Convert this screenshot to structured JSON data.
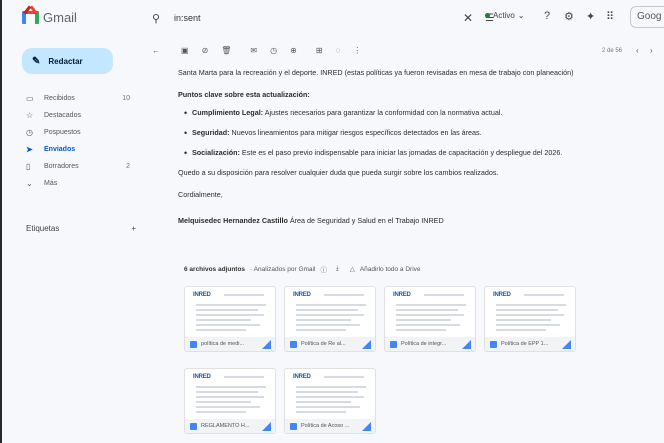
{
  "app": {
    "name": "Gmail"
  },
  "search": {
    "value": "in:sent"
  },
  "status": {
    "label": "Activo"
  },
  "account_button": "Goog",
  "compose_label": "Redactar",
  "nav": [
    {
      "label": "Recibidos",
      "icon": "inbox-icon",
      "count": "10",
      "active": false
    },
    {
      "label": "Destacados",
      "icon": "star-icon",
      "count": "",
      "active": false
    },
    {
      "label": "Pospuestos",
      "icon": "clock-icon",
      "count": "",
      "active": false
    },
    {
      "label": "Enviados",
      "icon": "send-icon",
      "count": "",
      "active": true
    },
    {
      "label": "Borradores",
      "icon": "draft-icon",
      "count": "2",
      "active": false
    },
    {
      "label": "Más",
      "icon": "chevron-down-icon",
      "count": "",
      "active": false
    }
  ],
  "labels_section": {
    "title": "Etiquetas",
    "add": "+"
  },
  "pagination": "2 de 56",
  "message": {
    "intro": "Santa Marta para la recreación y el deporte. INRED (estas políticas ya fueron revisadas en mesa de trabajo con planeación)",
    "heading": "Puntos clave sobre esta actualización:",
    "bullets": [
      {
        "title": "Cumplimiento Legal:",
        "text": " Ajustes necesarios para garantizar la conformidad con la normativa actual."
      },
      {
        "title": "Seguridad:",
        "text": " Nuevos lineamientos para mitigar riesgos específicos detectados en las áreas."
      },
      {
        "title": "Socialización:",
        "text": " Este es el paso previo indispensable para iniciar las jornadas de capacitación y despliegue del 2026."
      }
    ],
    "closing": "Quedo a su disposición para resolver cualquier duda que pueda surgir sobre los cambios realizados.",
    "greeting": "Cordialmente,",
    "signature_name": "Melquisedec Hernandez Castillo",
    "signature_role": " Área de Seguridad y Salud en el Trabajo INRED"
  },
  "attachments": {
    "count_label": "6 archivos adjuntos",
    "scan_label": "· Analizados por Gmail",
    "drive_label": "Añadirlo todo a Drive",
    "files": [
      {
        "name": "política de medi...",
        "logo": "INRED"
      },
      {
        "name": "Política de Re al...",
        "logo": "INRED"
      },
      {
        "name": "Política de integr...",
        "logo": "INRED"
      },
      {
        "name": "Política de EPP 1...",
        "logo": "INRED"
      },
      {
        "name": "REGLAMENTO H...",
        "logo": "INRED"
      },
      {
        "name": "Política de Acoso ...",
        "logo": "INRED"
      }
    ]
  }
}
